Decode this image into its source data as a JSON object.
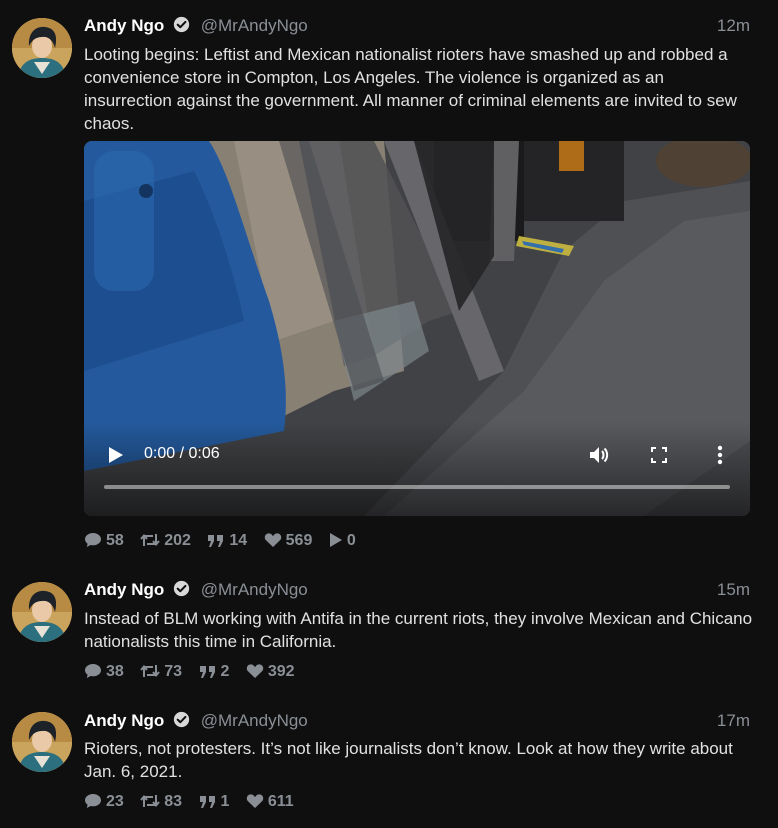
{
  "tweets": [
    {
      "fullname": "Andy Ngo",
      "username": "@MrAndyNgo",
      "date": "12m",
      "text": "Looting begins: Leftist and Mexican nationalist rioters have smashed up and robbed a convenience store in Compton, Los Angeles. The violence is organized as an insurrection against the government. All manner of criminal elements are invited to sew chaos.",
      "video": {
        "time": "0:00 / 0:06",
        "progress": 0
      },
      "stats": {
        "replies": "58",
        "retweets": "202",
        "quotes": "14",
        "likes": "569",
        "plays": "0"
      }
    },
    {
      "fullname": "Andy Ngo",
      "username": "@MrAndyNgo",
      "date": "15m",
      "text": "Instead of BLM working with Antifa in the current riots, they involve Mexican and Chicano nationalists this time in California.",
      "stats": {
        "replies": "38",
        "retweets": "73",
        "quotes": "2",
        "likes": "392"
      }
    },
    {
      "fullname": "Andy Ngo",
      "username": "@MrAndyNgo",
      "date": "17m",
      "text": "Rioters, not protesters. It’s not like journalists don’t know. Look at how they write about Jan. 6, 2021.",
      "stats": {
        "replies": "23",
        "retweets": "83",
        "quotes": "1",
        "likes": "611"
      }
    }
  ],
  "icons": {
    "verified": "verified-badge-icon",
    "reply": "comment-icon",
    "retweet": "retweet-icon",
    "quote": "quote-icon",
    "like": "heart-icon",
    "play": "play-icon",
    "volume": "volume-icon",
    "fullscreen": "fullscreen-icon",
    "more": "more-vertical-icon"
  },
  "colors": {
    "background": "#0f0f10",
    "name": "#ffffff",
    "muted": "#8a8f95",
    "text": "#e1e1e1"
  }
}
